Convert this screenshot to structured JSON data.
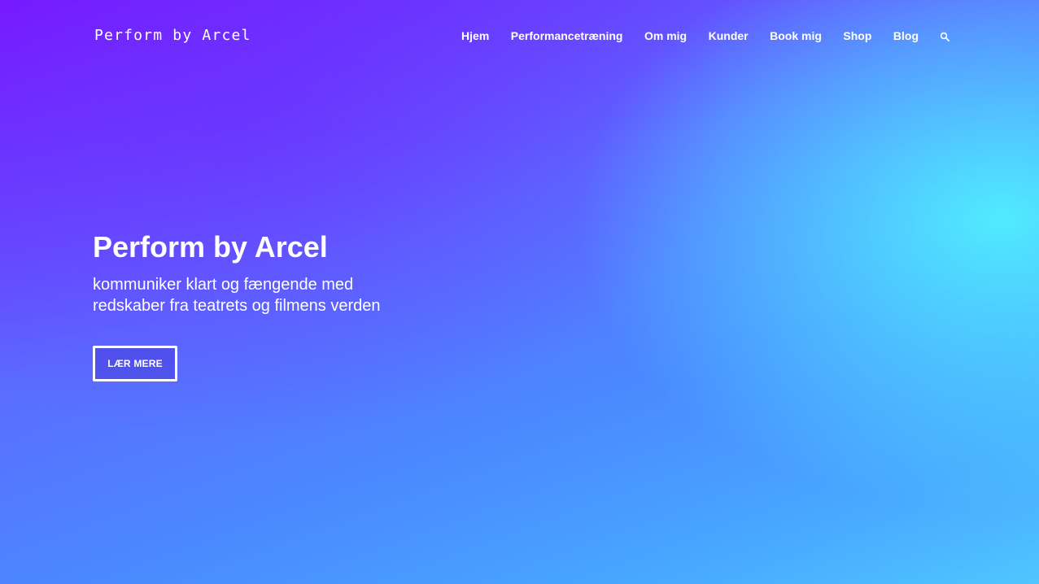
{
  "header": {
    "logo": "Perform by Arcel",
    "nav": [
      {
        "label": "Hjem"
      },
      {
        "label": "Performancetræning"
      },
      {
        "label": "Om mig"
      },
      {
        "label": "Kunder"
      },
      {
        "label": "Book mig"
      },
      {
        "label": "Shop"
      },
      {
        "label": "Blog"
      }
    ],
    "search_icon": "search-icon"
  },
  "hero": {
    "title": "Perform by Arcel",
    "subtitle": "kommuniker klart og fængende med redskaber fra teatrets og filmens verden",
    "button_label": "LÆR MERE"
  },
  "colors": {
    "gradient_start": "#7a14ff",
    "gradient_mid": "#4a8aff",
    "gradient_glow": "#50f0ff",
    "text": "#ffffff"
  }
}
